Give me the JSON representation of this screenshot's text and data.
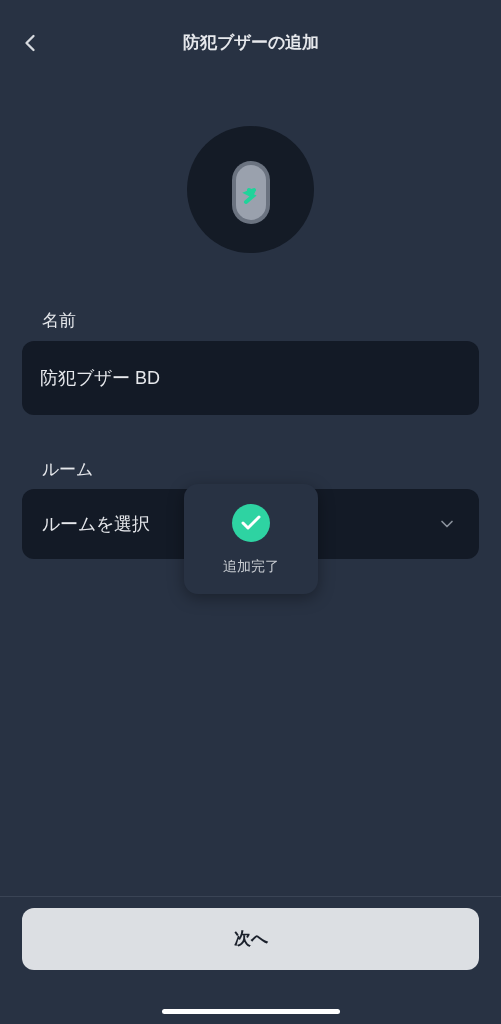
{
  "header": {
    "title": "防犯ブザーの追加"
  },
  "form": {
    "name_label": "名前",
    "name_value": "防犯ブザー BD",
    "room_label": "ルーム",
    "room_placeholder": "ルームを選択"
  },
  "toast": {
    "message": "追加完了"
  },
  "next_button": {
    "label": "次へ"
  }
}
